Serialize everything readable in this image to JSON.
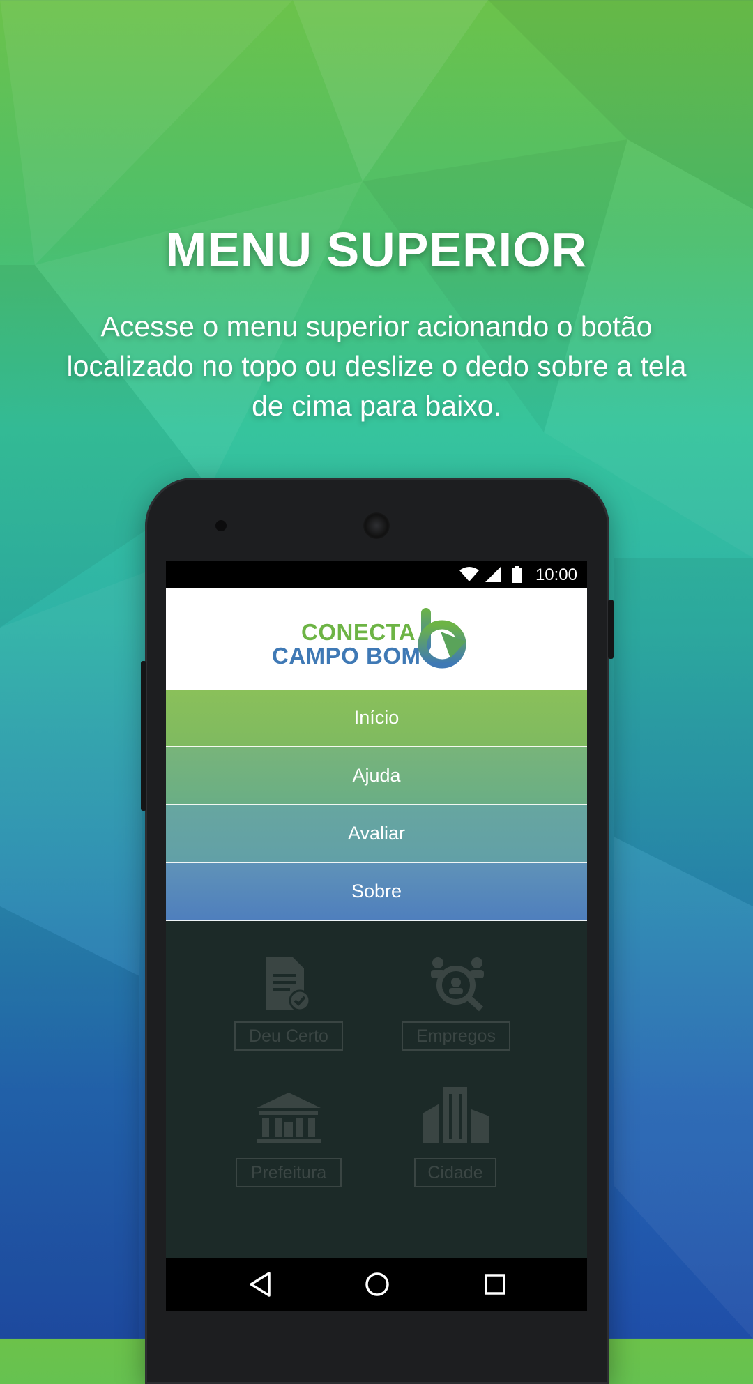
{
  "headline": "MENU SUPERIOR",
  "subtitle": "Acesse o menu superior acionando o botão localizado no topo ou deslize o dedo sobre a tela de cima para baixo.",
  "status_bar": {
    "time": "10:00",
    "icons": [
      "wifi-icon",
      "cellular-signal-icon",
      "battery-icon"
    ]
  },
  "app": {
    "logo": {
      "line1": "CONECTA",
      "line2": "CAMPO BOM"
    },
    "menu": [
      {
        "label": "Início"
      },
      {
        "label": "Ajuda"
      },
      {
        "label": "Avaliar"
      },
      {
        "label": "Sobre"
      }
    ],
    "tiles": [
      {
        "label": "Deu Certo",
        "icon": "document-check-icon"
      },
      {
        "label": "Empregos",
        "icon": "job-search-icon"
      },
      {
        "label": "Prefeitura",
        "icon": "city-hall-icon"
      },
      {
        "label": "Cidade",
        "icon": "city-buildings-icon"
      }
    ]
  },
  "nav_bar": {
    "buttons": [
      "back-icon",
      "home-icon",
      "recents-icon"
    ]
  },
  "colors": {
    "logo_green": "#6db445",
    "logo_blue": "#3f79b5",
    "menu_top": "#8ac05a",
    "menu_bottom": "#4f7fbd"
  }
}
